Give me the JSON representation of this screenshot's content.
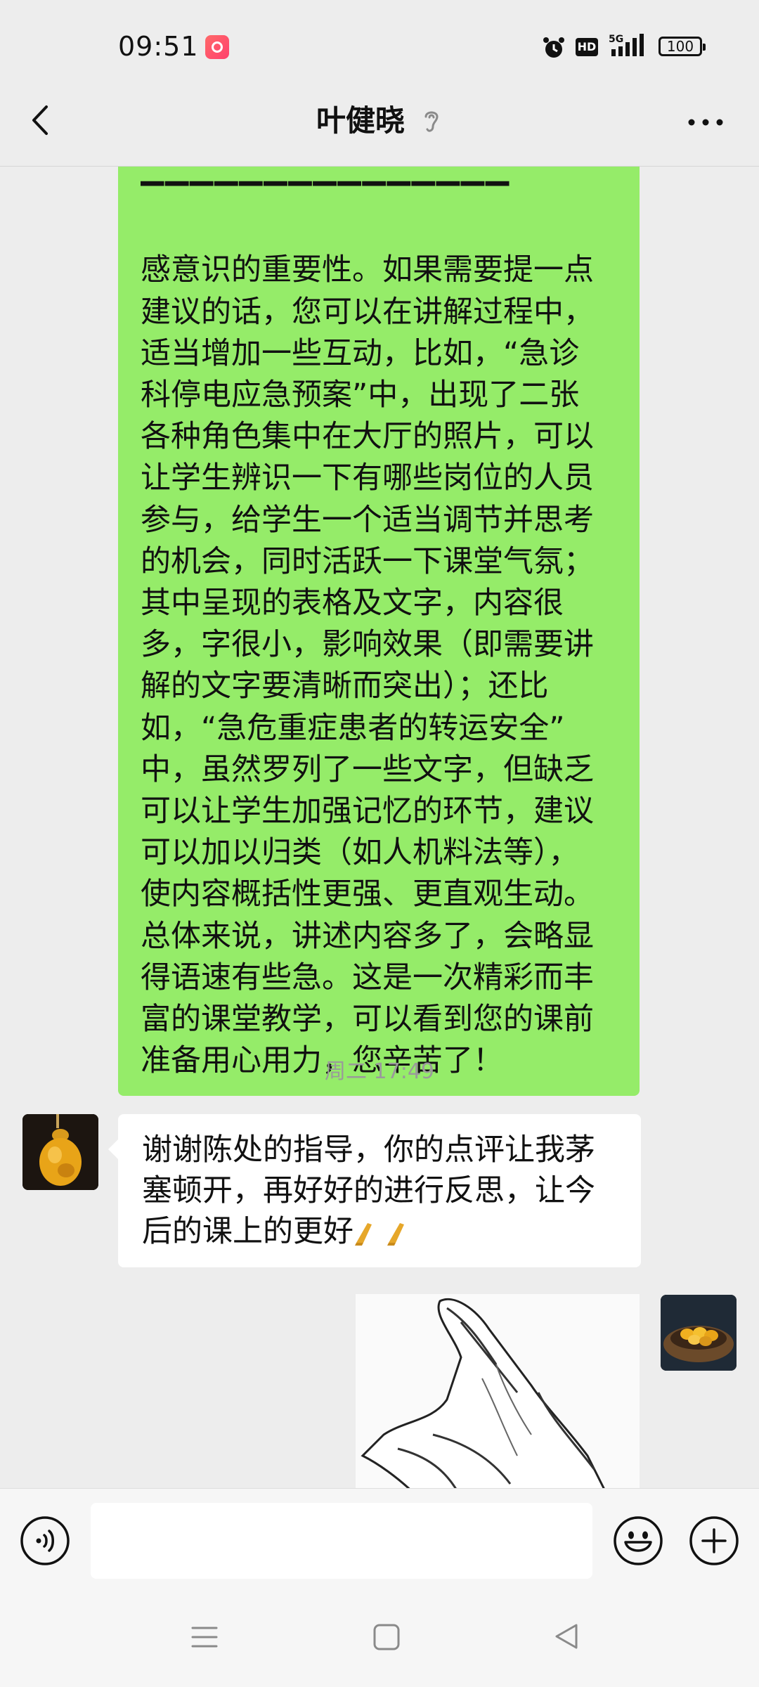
{
  "status_bar": {
    "time": "09:51",
    "hd_label": "HD",
    "network": "5G",
    "battery": "100"
  },
  "header": {
    "title": "叶健晓"
  },
  "messages": {
    "outgoing_text": "感意识的重要性。如果需要提一点\n建议的话，您可以在讲解过程中，\n适当增加一些互动，比如，“急诊\n科停电应急预案”中，出现了二张\n各种角色集中在大厅的照片，可以\n让学生辨识一下有哪些岗位的人员\n参与，给学生一个适当调节并思考\n的机会，同时活跃一下课堂气氛；\n其中呈现的表格及文字，内容很\n多，字很小，影响效果（即需要讲\n解的文字要清晰而突出）；还比\n如，“急危重症患者的转运安全”\n中，虽然罗列了一些文字，但缺乏\n可以让学生加强记忆的环节，建议\n可以加以归类（如人机料法等），\n使内容概括性更强、更直观生动。\n总体来说，讲述内容多了，会略显\n得语速有些急。这是一次精彩而丰\n富的课堂教学，可以看到您的课前\n准备用心用力，您辛苦了！",
    "timestamp": "周二 17:49",
    "incoming_text": "谢谢陈处的指导，你的点评让我茅塞顿开，再好好的进行反思，让今后的课上的更好"
  },
  "input": {
    "value": "",
    "placeholder": ""
  },
  "icons": {
    "back": "chevron-left-icon",
    "earpiece": "earpiece-icon",
    "more": "more-icon",
    "voice": "voice-icon",
    "emoji": "emoji-icon",
    "plus": "plus-icon"
  },
  "colors": {
    "outgoing_bubble": "#95ec69",
    "incoming_bubble": "#ffffff",
    "background": "#ededed"
  }
}
